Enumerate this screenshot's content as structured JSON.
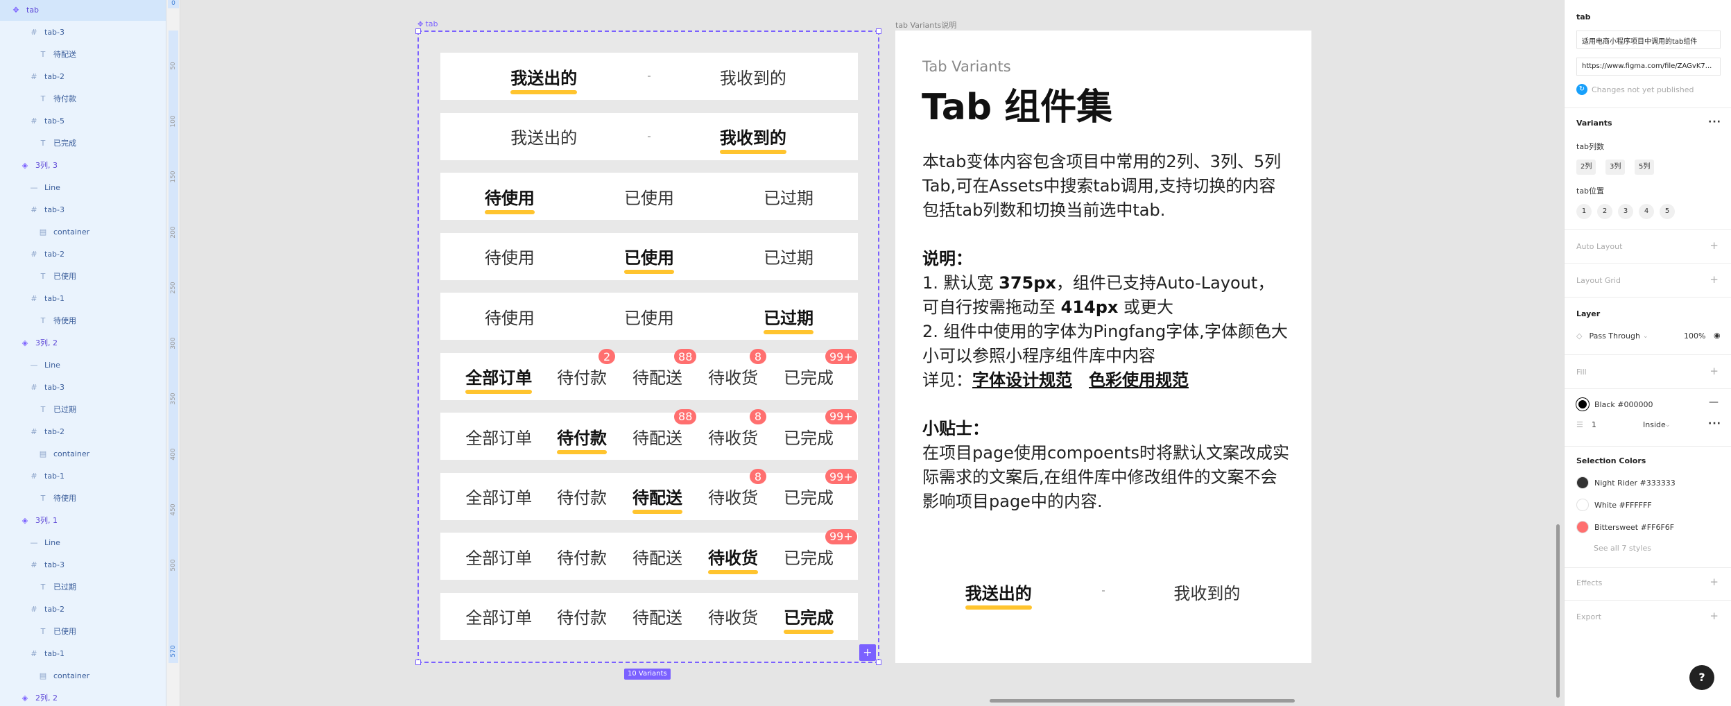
{
  "layers": [
    {
      "label": "tab",
      "icon": "component-icon",
      "indent": 0,
      "selected": true
    },
    {
      "label": "tab-3",
      "icon": "frame-icon",
      "indent": 2
    },
    {
      "label": "待配送",
      "icon": "text-icon",
      "indent": 3
    },
    {
      "label": "tab-2",
      "icon": "frame-icon",
      "indent": 2
    },
    {
      "label": "待付款",
      "icon": "text-icon",
      "indent": 3
    },
    {
      "label": "tab-5",
      "icon": "frame-icon",
      "indent": 2
    },
    {
      "label": "已完成",
      "icon": "text-icon",
      "indent": 3
    },
    {
      "label": "3列, 3",
      "icon": "variant-icon",
      "indent": 1
    },
    {
      "label": "Line",
      "icon": "line-icon",
      "indent": 2
    },
    {
      "label": "tab-3",
      "icon": "frame-icon",
      "indent": 2
    },
    {
      "label": "container",
      "icon": "container-icon",
      "indent": 3
    },
    {
      "label": "tab-2",
      "icon": "frame-icon",
      "indent": 2
    },
    {
      "label": "已使用",
      "icon": "text-icon",
      "indent": 3
    },
    {
      "label": "tab-1",
      "icon": "frame-icon",
      "indent": 2
    },
    {
      "label": "待使用",
      "icon": "text-icon",
      "indent": 3
    },
    {
      "label": "3列, 2",
      "icon": "variant-icon",
      "indent": 1
    },
    {
      "label": "Line",
      "icon": "line-icon",
      "indent": 2
    },
    {
      "label": "tab-3",
      "icon": "frame-icon",
      "indent": 2
    },
    {
      "label": "已过期",
      "icon": "text-icon",
      "indent": 3
    },
    {
      "label": "tab-2",
      "icon": "frame-icon",
      "indent": 2
    },
    {
      "label": "container",
      "icon": "container-icon",
      "indent": 3
    },
    {
      "label": "tab-1",
      "icon": "frame-icon",
      "indent": 2
    },
    {
      "label": "待使用",
      "icon": "text-icon",
      "indent": 3
    },
    {
      "label": "3列, 1",
      "icon": "variant-icon",
      "indent": 1
    },
    {
      "label": "Line",
      "icon": "line-icon",
      "indent": 2
    },
    {
      "label": "tab-3",
      "icon": "frame-icon",
      "indent": 2
    },
    {
      "label": "已过期",
      "icon": "text-icon",
      "indent": 3
    },
    {
      "label": "tab-2",
      "icon": "frame-icon",
      "indent": 2
    },
    {
      "label": "已使用",
      "icon": "text-icon",
      "indent": 3
    },
    {
      "label": "tab-1",
      "icon": "frame-icon",
      "indent": 2
    },
    {
      "label": "container",
      "icon": "container-icon",
      "indent": 3
    },
    {
      "label": "2列, 2",
      "icon": "variant-icon",
      "indent": 1
    }
  ],
  "ruler": {
    "ticks": [
      "50",
      "100",
      "150",
      "200",
      "250",
      "300",
      "350",
      "400",
      "450",
      "500"
    ],
    "top_value": "0",
    "end_value": "570"
  },
  "canvas": {
    "frame_label": "tab",
    "desc_frame_label": "tab Variants说明",
    "variants_count": "10 Variants",
    "add_label": "+"
  },
  "variants": [
    {
      "type": "2col",
      "tabs": [
        "我送出的",
        "我收到的"
      ],
      "active": 0
    },
    {
      "type": "2col",
      "tabs": [
        "我送出的",
        "我收到的"
      ],
      "active": 1
    },
    {
      "type": "3col",
      "tabs": [
        "待使用",
        "已使用",
        "已过期"
      ],
      "active": 0
    },
    {
      "type": "3col",
      "tabs": [
        "待使用",
        "已使用",
        "已过期"
      ],
      "active": 1
    },
    {
      "type": "3col",
      "tabs": [
        "待使用",
        "已使用",
        "已过期"
      ],
      "active": 2
    },
    {
      "type": "5col",
      "tabs": [
        "全部订单",
        "待付款",
        "待配送",
        "待收货",
        "已完成"
      ],
      "badges": [
        "",
        "2",
        "88",
        "8",
        "99+"
      ],
      "active": 0
    },
    {
      "type": "5col",
      "tabs": [
        "全部订单",
        "待付款",
        "待配送",
        "待收货",
        "已完成"
      ],
      "badges": [
        "",
        "",
        "88",
        "8",
        "99+"
      ],
      "active": 1
    },
    {
      "type": "5col",
      "tabs": [
        "全部订单",
        "待付款",
        "待配送",
        "待收货",
        "已完成"
      ],
      "badges": [
        "",
        "",
        "",
        "8",
        "99+"
      ],
      "active": 2
    },
    {
      "type": "5col",
      "tabs": [
        "全部订单",
        "待付款",
        "待配送",
        "待收货",
        "已完成"
      ],
      "badges": [
        "",
        "",
        "",
        "",
        "99+"
      ],
      "active": 3
    },
    {
      "type": "5col",
      "tabs": [
        "全部订单",
        "待付款",
        "待配送",
        "待收货",
        "已完成"
      ],
      "badges": [
        "",
        "",
        "",
        "",
        ""
      ],
      "active": 4
    }
  ],
  "description": {
    "subtitle": "Tab Variants",
    "title": "Tab 组件集",
    "intro": "本tab变体内容包含项目中常用的2列、3列、5列Tab,可在Assets中搜索tab调用,支持切换的内容包括tab列数和切换当前选中tab.",
    "notes_heading": "说明：",
    "note1_a": "1. 默认宽 ",
    "note1_b": "375px",
    "note1_c": "，组件已支持Auto-Layout，可自行按需拖动至 ",
    "note1_d": "414px",
    "note1_e": " 或更大",
    "note2": "2. 组件中使用的字体为Pingfang字体,字体颜色大小可以参照小程序组件库中内容",
    "see_label": "详见：",
    "link1": "字体设计规范",
    "link2": "色彩使用规范",
    "tips_heading": "小贴士：",
    "tips": "在项目page使用compoents时将默认文案改成实际需求的文案后,在组件库中修改组件的文案不会影响项目page中的内容."
  },
  "demo_tab": {
    "tabs": [
      "我送出的",
      "我收到的"
    ],
    "active": 0
  },
  "props": {
    "component_name": "tab",
    "description_value": "适用电商小程序项目中调用的tab组件",
    "link_value": "https://www.figma.com/file/ZAGvK7...",
    "publish_status": "Changes not yet published",
    "variants_title": "Variants",
    "prop1_label": "tab列数",
    "prop1_options": [
      "2列",
      "3列",
      "5列"
    ],
    "prop2_label": "tab位置",
    "prop2_options": [
      "1",
      "2",
      "3",
      "4",
      "5"
    ],
    "auto_layout": "Auto Layout",
    "layout_grid": "Layout Grid",
    "layer_title": "Layer",
    "blend_mode": "Pass Through",
    "opacity": "100%",
    "fill_title": "Fill",
    "stroke_color_name": "Black #000000",
    "stroke_width": "1",
    "stroke_position": "Inside",
    "selection_colors_title": "Selection Colors",
    "selection_colors": [
      {
        "name": "Night Rider #333333",
        "hex": "#333333"
      },
      {
        "name": "White #FFFFFF",
        "hex": "#FFFFFF"
      },
      {
        "name": "Bittersweet #FF6F6F",
        "hex": "#FF6F6F"
      }
    ],
    "see_all": "See all 7 styles",
    "effects_title": "Effects",
    "export_title": "Export",
    "help": "?"
  },
  "colors": {
    "accent": "#7b61ff",
    "underline": "#ffc42e",
    "badge": "#ff6f6f"
  }
}
